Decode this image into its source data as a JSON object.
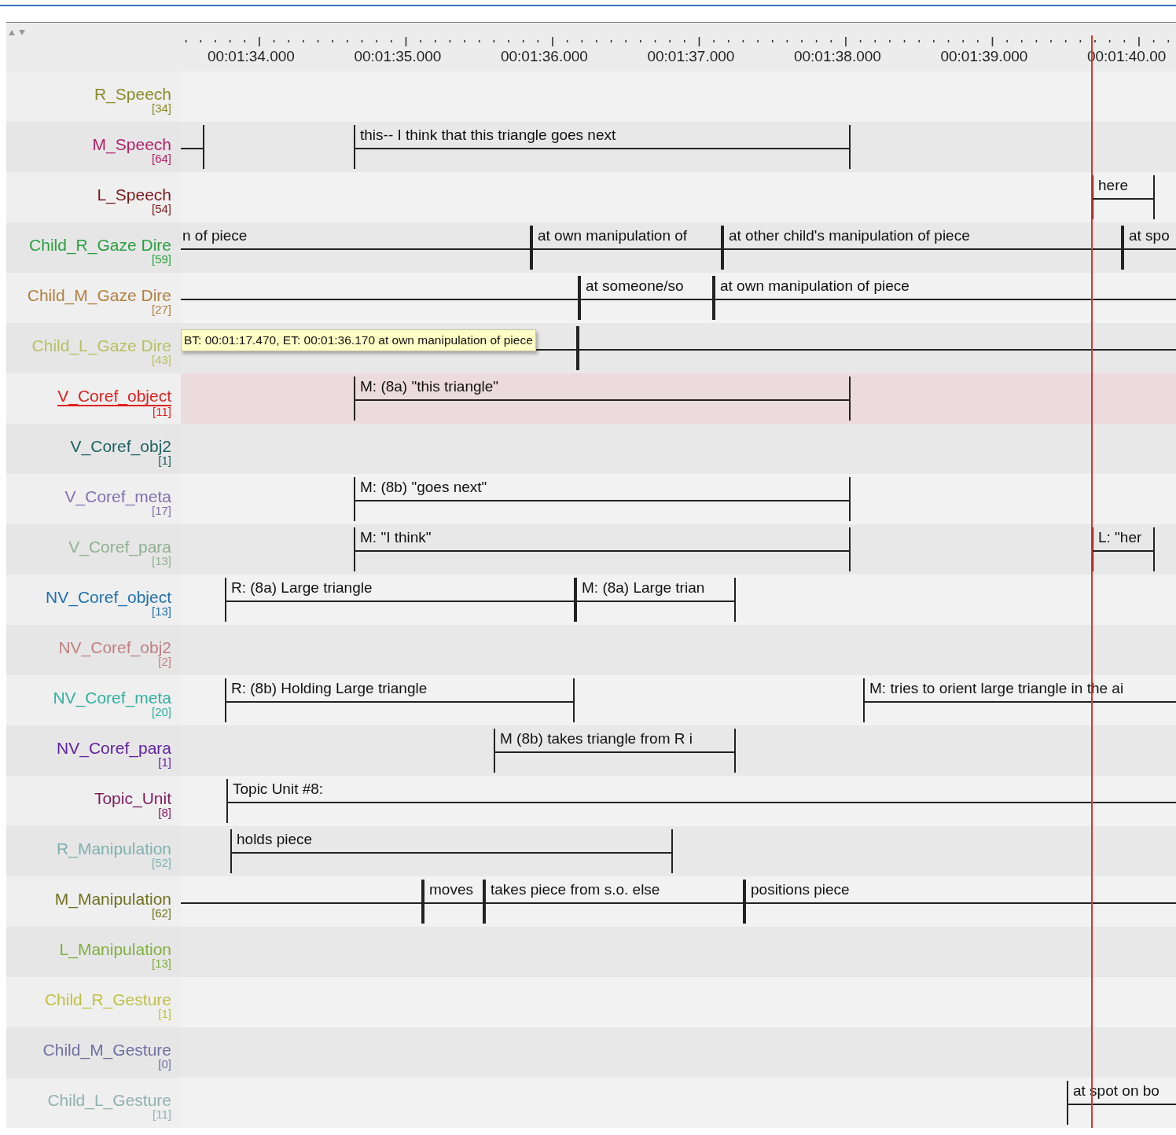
{
  "ruler": {
    "labels": [
      "00:01:34.000",
      "00:01:35.000",
      "00:01:36.000",
      "00:01:37.000",
      "00:01:38.000",
      "00:01:39.000",
      "00:01:40.00"
    ]
  },
  "tiers": [
    {
      "name": "R_Speech",
      "count": "[34]",
      "color": "#8a8a2a",
      "selected": false
    },
    {
      "name": "M_Speech",
      "count": "[64]",
      "color": "#b0206a",
      "selected": false,
      "annotations": [
        "this-- I think that this triangle goes next"
      ]
    },
    {
      "name": "L_Speech",
      "count": "[54]",
      "color": "#7a1a1a",
      "selected": false,
      "annotations": [
        "here"
      ]
    },
    {
      "name": "Child_R_Gaze Dire",
      "count": "[59]",
      "color": "#2aa040",
      "selected": false,
      "annotations": [
        "n of piece",
        "at own manipulation of",
        "at other child's manipulation of piece",
        "at spo"
      ]
    },
    {
      "name": "Child_M_Gaze Dire",
      "count": "[27]",
      "color": "#b08040",
      "selected": false,
      "annotations": [
        "at someone/so",
        "at own manipulation of piece"
      ]
    },
    {
      "name": "Child_L_Gaze Dire",
      "count": "[43]",
      "color": "#b8c060",
      "selected": false,
      "tooltip": "BT: 00:01:17.470, ET: 00:01:36.170 at own manipulation of piece"
    },
    {
      "name": "V_Coref_object",
      "count": "[11]",
      "color": "#e02020",
      "selected": true,
      "annotations": [
        "M: (8a) \"this triangle\""
      ]
    },
    {
      "name": "V_Coref_obj2",
      "count": "[1]",
      "color": "#206060",
      "selected": false
    },
    {
      "name": "V_Coref_meta",
      "count": "[17]",
      "color": "#8070b0",
      "selected": false,
      "annotations": [
        "M: (8b) \"goes next\""
      ]
    },
    {
      "name": "V_Coref_para",
      "count": "[13]",
      "color": "#90b090",
      "selected": false,
      "annotations": [
        "M: \"I think\"",
        "L: \"her"
      ]
    },
    {
      "name": "NV_Coref_object",
      "count": "[13]",
      "color": "#2070b0",
      "selected": false,
      "annotations": [
        "R: (8a) Large triangle",
        "M: (8a) Large trian"
      ]
    },
    {
      "name": "NV_Coref_obj2",
      "count": "[2]",
      "color": "#c08080",
      "selected": false
    },
    {
      "name": "NV_Coref_meta",
      "count": "[20]",
      "color": "#30b0a0",
      "selected": false,
      "annotations": [
        "R: (8b) Holding Large triangle",
        "M: tries to orient large triangle in the ai"
      ]
    },
    {
      "name": "NV_Coref_para",
      "count": "[1]",
      "color": "#6020a0",
      "selected": false,
      "annotations": [
        "M (8b) takes triangle from R i"
      ]
    },
    {
      "name": "Topic_Unit",
      "count": "[8]",
      "color": "#802060",
      "selected": false,
      "annotations": [
        "Topic Unit #8:"
      ]
    },
    {
      "name": "R_Manipulation",
      "count": "[52]",
      "color": "#80b0b0",
      "selected": false,
      "annotations": [
        "holds piece"
      ]
    },
    {
      "name": "M_Manipulation",
      "count": "[62]",
      "color": "#707020",
      "selected": false,
      "annotations": [
        "moves",
        "takes piece from s.o. else",
        "positions piece"
      ]
    },
    {
      "name": "L_Manipulation",
      "count": "[13]",
      "color": "#80b040",
      "selected": false
    },
    {
      "name": "Child_R_Gesture",
      "count": "[1]",
      "color": "#c0c040",
      "selected": false
    },
    {
      "name": "Child_M_Gesture",
      "count": "[0]",
      "color": "#7070a0",
      "selected": false
    },
    {
      "name": "Child_L_Gesture",
      "count": "[11]",
      "color": "#90b0b0",
      "selected": false,
      "annotations": [
        "at spot on bo"
      ]
    }
  ]
}
